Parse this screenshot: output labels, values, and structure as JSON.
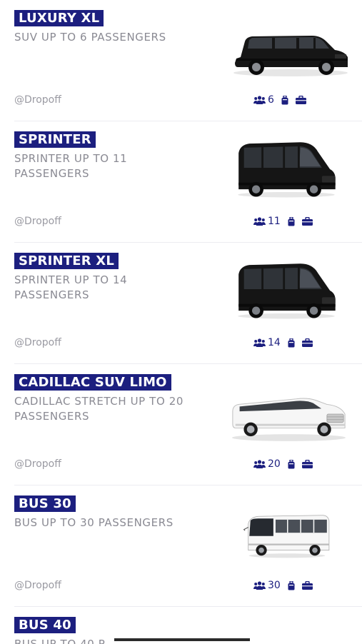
{
  "vehicles": [
    {
      "title": "LUXURY XL",
      "description": "SUV UP TO 6 PASSENGERS",
      "dropoff": "@Dropoff",
      "passengers": "6",
      "image": "black-suv-image"
    },
    {
      "title": "SPRINTER",
      "description": "SPRINTER UP TO 11 PASSENGERS",
      "dropoff": "@Dropoff",
      "passengers": "11",
      "image": "black-sprinter-van-image"
    },
    {
      "title": "SPRINTER XL",
      "description": "SPRINTER UP TO 14 PASSENGERS",
      "dropoff": "@Dropoff",
      "passengers": "14",
      "image": "black-sprinter-van-image"
    },
    {
      "title": "CADILLAC SUV LIMO",
      "description": "CADILLAC STRETCH UP TO 20 PASSENGERS",
      "dropoff": "@Dropoff",
      "passengers": "20",
      "image": "white-stretch-limo-image"
    },
    {
      "title": "BUS 30",
      "description": "BUS UP TO 30 PASSENGERS",
      "dropoff": "@Dropoff",
      "passengers": "30",
      "image": "white-coach-bus-image"
    },
    {
      "title": "BUS 40",
      "description": "BUS UP TO 40 P",
      "partial": true
    }
  ],
  "icons": {
    "passengers": "users-icon",
    "luggage": "suitcase-icon",
    "bag": "briefcase-icon"
  },
  "colors": {
    "accent": "#1c1f7f",
    "muted_text": "#8a8a93",
    "divider": "#ececf1",
    "background": "#ffffff"
  }
}
